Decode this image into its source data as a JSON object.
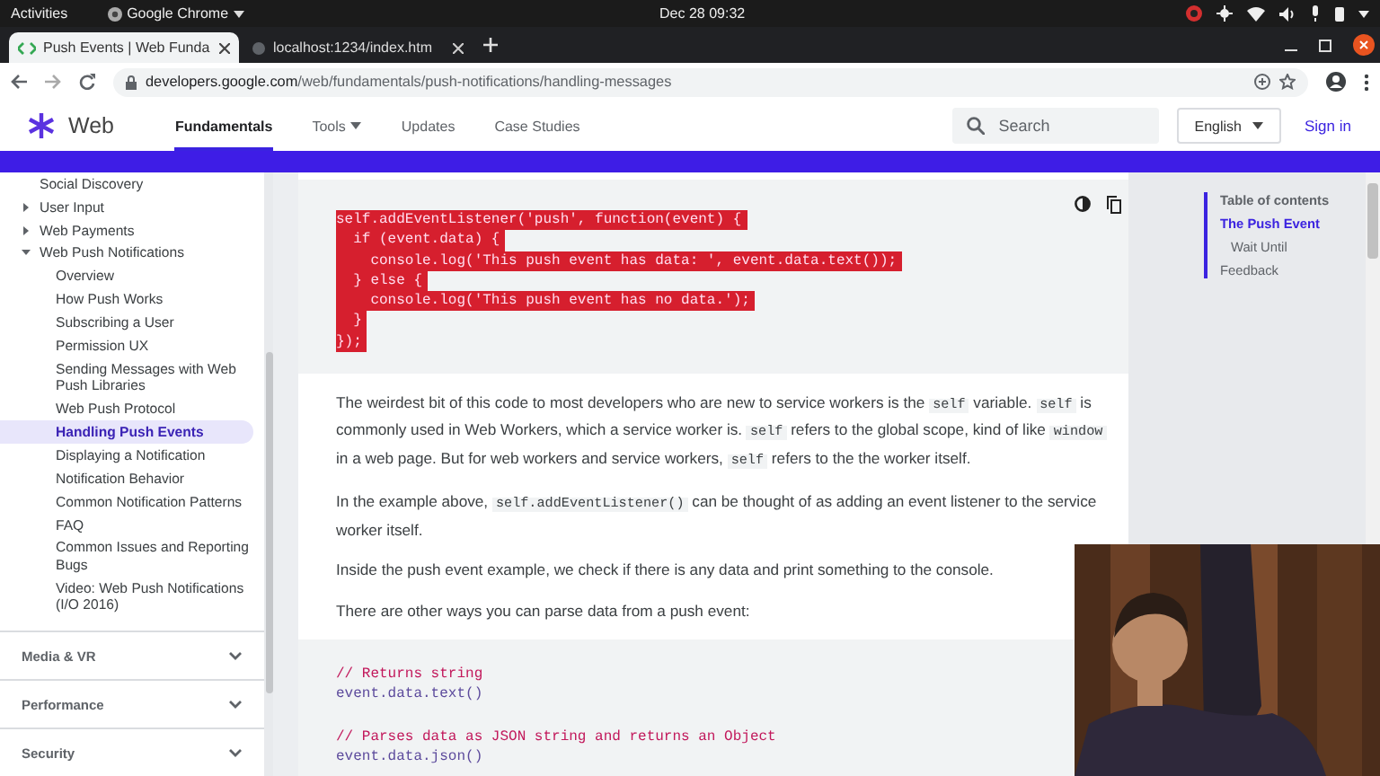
{
  "top_bar": {
    "activities": "Activities",
    "app_menu": "Google Chrome",
    "clock": "Dec 28  09:32"
  },
  "tabs": [
    {
      "title": "Push Events | Web Funda",
      "selected": true
    },
    {
      "title": "localhost:1234/index.htm",
      "selected": false
    }
  ],
  "address_bar": {
    "domain": "developers.google.com",
    "path": "/web/fundamentals/push-notifications/handling-messages"
  },
  "site_header": {
    "logo_text": "Web",
    "nav": [
      {
        "label": "Fundamentals",
        "selected": true,
        "dropdown": false
      },
      {
        "label": "Tools",
        "selected": false,
        "dropdown": true
      },
      {
        "label": "Updates",
        "selected": false,
        "dropdown": false
      },
      {
        "label": "Case Studies",
        "selected": false,
        "dropdown": false
      }
    ],
    "search": {
      "placeholder": "Search"
    },
    "language": "English",
    "sign_in": "Sign in"
  },
  "sidebar": {
    "items": [
      {
        "label": "Social Discovery",
        "selected": false
      },
      {
        "label": "User Input",
        "selected": false,
        "expanded": false
      },
      {
        "label": "Web Payments",
        "selected": false,
        "expanded": false
      },
      {
        "label": "Web Push Notifications",
        "selected": false,
        "expanded": true,
        "children": [
          {
            "label": "Overview",
            "selected": false
          },
          {
            "label": "How Push Works",
            "selected": false
          },
          {
            "label": "Subscribing a User",
            "selected": false
          },
          {
            "label": "Permission UX",
            "selected": false
          },
          {
            "label": "Sending Messages with Web Push Libraries",
            "selected": false
          },
          {
            "label": "Web Push Protocol",
            "selected": false
          },
          {
            "label": "Handling Push Events",
            "selected": true
          },
          {
            "label": "Displaying a Notification",
            "selected": false
          },
          {
            "label": "Notification Behavior",
            "selected": false
          },
          {
            "label": "Common Notification Patterns",
            "selected": false
          },
          {
            "label": "FAQ",
            "selected": false
          },
          {
            "label": "Common Issues and Reporting Bugs",
            "selected": false
          },
          {
            "label": "Video: Web Push Notifications (I/O 2016)",
            "selected": false
          }
        ]
      }
    ],
    "sections": [
      {
        "label": "Media & VR",
        "expanded": false
      },
      {
        "label": "Performance",
        "expanded": false
      },
      {
        "label": "Security",
        "expanded": false
      }
    ]
  },
  "article": [
    {
      "kind": "code",
      "selected": true,
      "groups": [
        [
          {
            "text": "self.addEventListener('push', function(event) {",
            "kind": "code"
          },
          {
            "text": "  if (event.data) {",
            "kind": "code"
          },
          {
            "text": "    console.log('This push event has data: ', event.data.text());",
            "kind": "code"
          },
          {
            "text": "  } else {",
            "kind": "code"
          },
          {
            "text": "    console.log('This push event has no data.');",
            "kind": "code"
          },
          {
            "text": "  }",
            "kind": "code"
          },
          {
            "text": "});",
            "kind": "code"
          }
        ]
      ]
    },
    {
      "kind": "paragraph",
      "segments": [
        {
          "text": "The weirdest bit of this code to most developers who are new to service workers is the ",
          "kind": "text"
        },
        {
          "text": "self",
          "kind": "code"
        },
        {
          "text": " variable. ",
          "kind": "text"
        },
        {
          "text": "self",
          "kind": "code"
        },
        {
          "text": " is commonly used in Web Workers, which a service worker is. ",
          "kind": "text"
        },
        {
          "text": "self",
          "kind": "code"
        },
        {
          "text": " refers to the global scope, kind of like ",
          "kind": "text"
        },
        {
          "text": "window",
          "kind": "code"
        },
        {
          "text": " in a web page. But for web workers and service workers, ",
          "kind": "text"
        },
        {
          "text": "self",
          "kind": "code"
        },
        {
          "text": " refers to the the worker itself.",
          "kind": "text"
        }
      ]
    },
    {
      "kind": "paragraph",
      "segments": [
        {
          "text": "In the example above, ",
          "kind": "text"
        },
        {
          "text": "self.addEventListener()",
          "kind": "code"
        },
        {
          "text": " can be thought of as adding an event listener to the service worker itself.",
          "kind": "text"
        }
      ]
    },
    {
      "kind": "paragraph",
      "segments": [
        {
          "text": "Inside the push event example, we check if there is any data and print something to the console.",
          "kind": "text"
        }
      ]
    },
    {
      "kind": "paragraph",
      "segments": [
        {
          "text": "There are other ways you can parse data from a push event:",
          "kind": "text"
        }
      ]
    },
    {
      "kind": "code",
      "selected": false,
      "groups": [
        [
          {
            "text": "// Returns string",
            "kind": "comment"
          },
          {
            "text": "event.data.text()",
            "kind": "code"
          }
        ],
        [
          {
            "text": "// Parses data as JSON string and returns an Object",
            "kind": "comment"
          },
          {
            "text": "event.data.json()",
            "kind": "code"
          }
        ]
      ]
    }
  ],
  "toc": {
    "title": "Table of contents",
    "items": [
      {
        "label": "The Push Event",
        "selected": true,
        "children": [
          {
            "label": "Wait Until",
            "selected": false
          }
        ]
      },
      {
        "label": "Feedback",
        "selected": false
      }
    ]
  }
}
